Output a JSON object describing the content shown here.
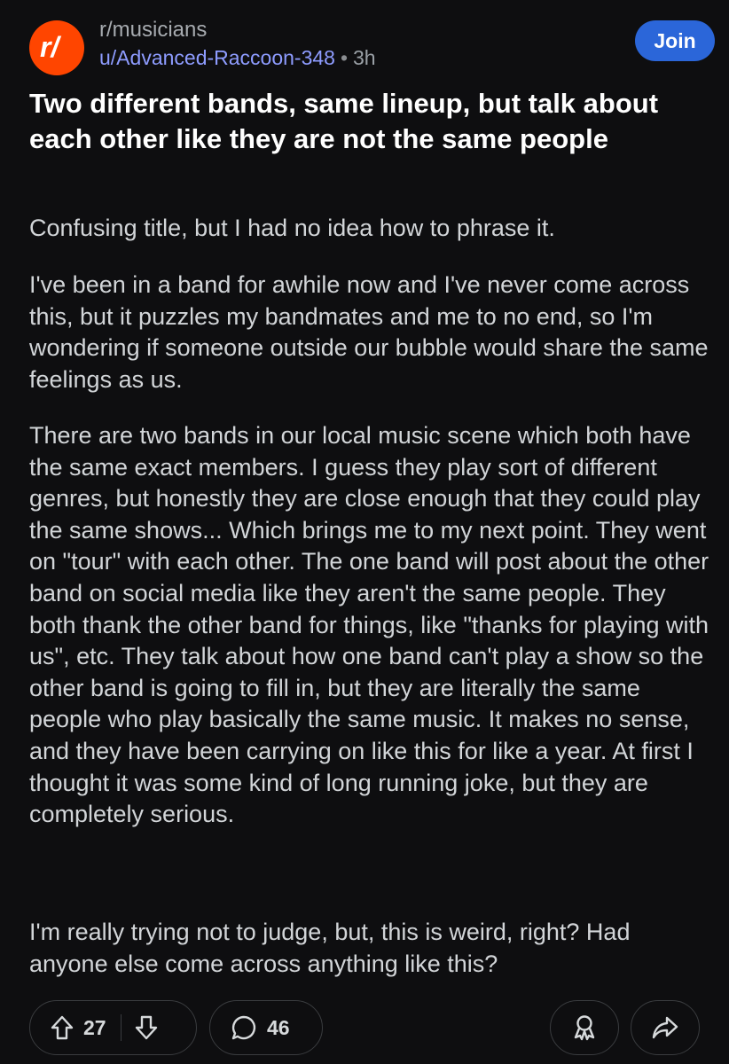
{
  "post": {
    "subreddit": "r/musicians",
    "author": "u/Advanced-Raccoon-348",
    "separator": "•",
    "time": "3h",
    "join_label": "Join",
    "avatar_text": "r/",
    "title": "Two different bands, same lineup, but talk about each other like they are not the same people",
    "paragraphs": [
      "Confusing title, but I had no idea how to phrase it.",
      "I've been in a band for awhile now and I've never come across this, but it puzzles my bandmates and me to no end, so I'm wondering if someone outside our bubble would share the same feelings as us.",
      "There are two bands in our local music scene which both have the same exact members. I guess they play sort of different genres, but honestly they are close enough that they could play the same shows... Which brings me to my next point. They went on \"tour\" with each other.  The one band will post about the other band on social media like they aren't the same people. They both thank the other band for things, like \"thanks for playing with us\", etc.  They talk about how one band can't play a show so the other band is going to fill in, but they are literally the same people who play basically the same music. It makes no sense, and they have been carrying on like this for like a year. At first I thought it was some kind of long running joke, but they are completely serious.",
      "I'm really trying not to judge, but, this is weird, right? Had anyone else come across anything like this?"
    ]
  },
  "actions": {
    "upvotes": "27",
    "comments": "46",
    "icons": [
      "upvote-icon",
      "downvote-icon",
      "comment-icon",
      "award-icon",
      "share-icon"
    ]
  },
  "colors": {
    "background": "#0e0e10",
    "brand": "#ff4500",
    "join_button": "#2b66d9",
    "author_link": "#8e9cff"
  }
}
